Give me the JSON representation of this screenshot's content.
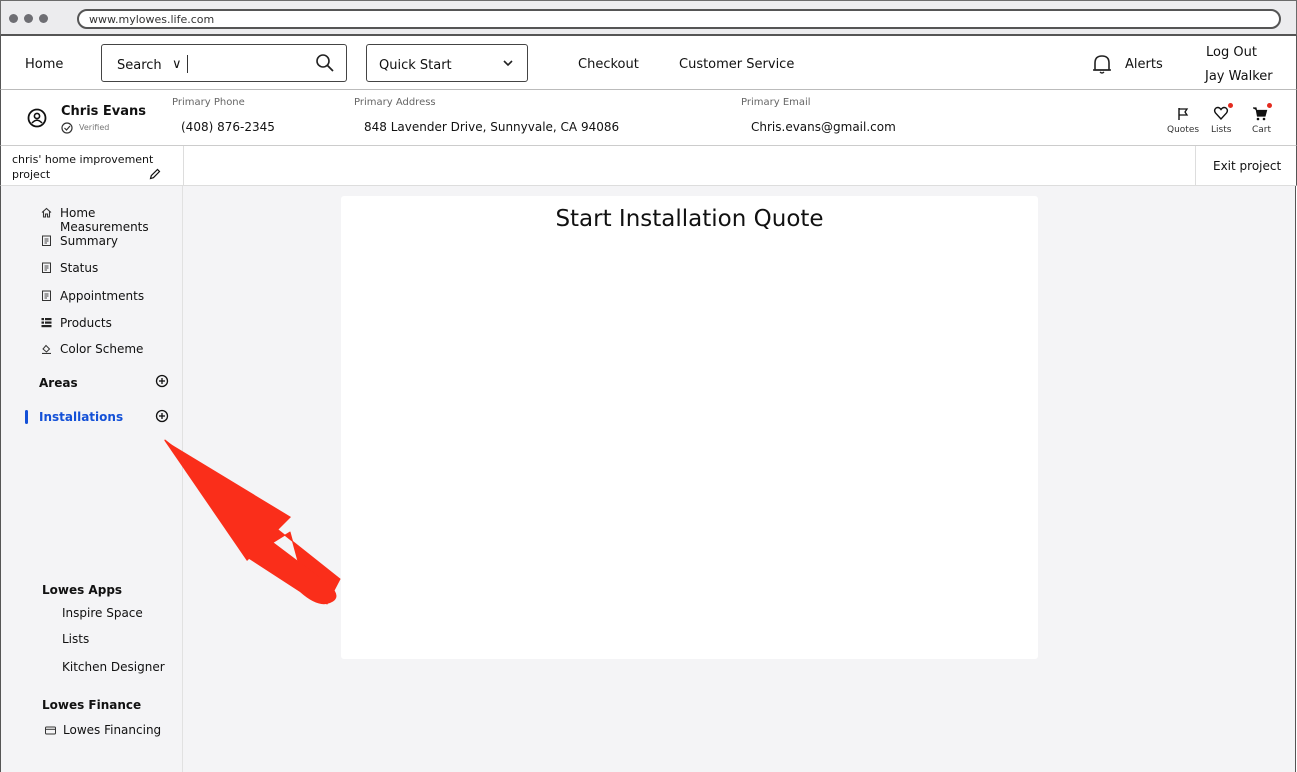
{
  "browser": {
    "url": "www.mylowes.life.com"
  },
  "nav": {
    "home": "Home",
    "search_label": "Search",
    "search_chevron": "∨",
    "quick_start": "Quick Start",
    "checkout": "Checkout",
    "customer_service": "Customer Service",
    "alerts": "Alerts",
    "logout": "Log Out",
    "user": "Jay Walker"
  },
  "customer": {
    "name": "Chris Evans",
    "verified": "Verified",
    "phone_label": "Primary Phone",
    "phone": "(408) 876-2345",
    "address_label": "Primary Address",
    "address": "848 Lavender Drive, Sunnyvale, CA 94086",
    "email_label": "Primary Email",
    "email": "Chris.evans@gmail.com",
    "quotes": "Quotes",
    "lists": "Lists",
    "cart": "Cart"
  },
  "project": {
    "name": "chris' home improvement project",
    "exit": "Exit project"
  },
  "sidebar": {
    "items": [
      {
        "label": "Home Measurements",
        "icon": "house-icon"
      },
      {
        "label": "Summary",
        "icon": "clipboard-icon"
      },
      {
        "label": "Status",
        "icon": "clipboard-icon"
      },
      {
        "label": "Appointments",
        "icon": "clipboard-icon"
      },
      {
        "label": "Products",
        "icon": "list-icon"
      },
      {
        "label": "Color Scheme",
        "icon": "paint-bucket-icon"
      }
    ],
    "areas": "Areas",
    "installations": "Installations",
    "apps_head": "Lowes Apps",
    "apps": [
      "Inspire Space",
      "Lists",
      "Kitchen Designer"
    ],
    "finance_head": "Lowes Finance",
    "financing": "Lowes Financing"
  },
  "main": {
    "title": "Start Installation Quote"
  },
  "colors": {
    "active": "#1350d7",
    "badge": "#e32b1f",
    "arrow": "#fa2e1a",
    "panel": "#f4f4f6"
  }
}
